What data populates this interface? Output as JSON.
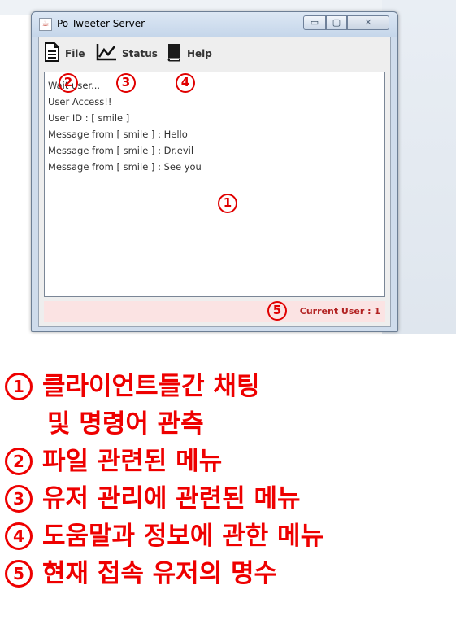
{
  "window": {
    "title": "Po Tweeter Server",
    "buttons": {
      "minimize": "▭",
      "maximize": "▢",
      "close": "✕"
    }
  },
  "toolbar": [
    {
      "label": "File",
      "icon": "document-icon"
    },
    {
      "label": "Status",
      "icon": "line-chart-icon"
    },
    {
      "label": "Help",
      "icon": "book-icon"
    }
  ],
  "log": [
    "Wait user...",
    "User Access!!",
    "User ID : [ smile ]",
    "Message from [ smile ] : Hello",
    "Message from [ smile ] : Dr.evil",
    "Message from [ smile ] : See you"
  ],
  "statusbar": {
    "current_user": "Current User : 1"
  },
  "annotations": {
    "n1": "1",
    "n2": "2",
    "n3": "3",
    "n4": "4",
    "n5": "5"
  },
  "legend": {
    "l1a": "클라이언트들간 채팅",
    "l1b": "및 명령어 관측",
    "l2": "파일 관련된 메뉴",
    "l3": "유저 관리에 관련된 메뉴",
    "l4": "도움말과 정보에 관한 메뉴",
    "l5": "현재 접속 유저의 명수"
  },
  "colors": {
    "annotation": "#ee0000",
    "status_text": "#b22222",
    "statusbar_bg": "#fbe3e3"
  }
}
